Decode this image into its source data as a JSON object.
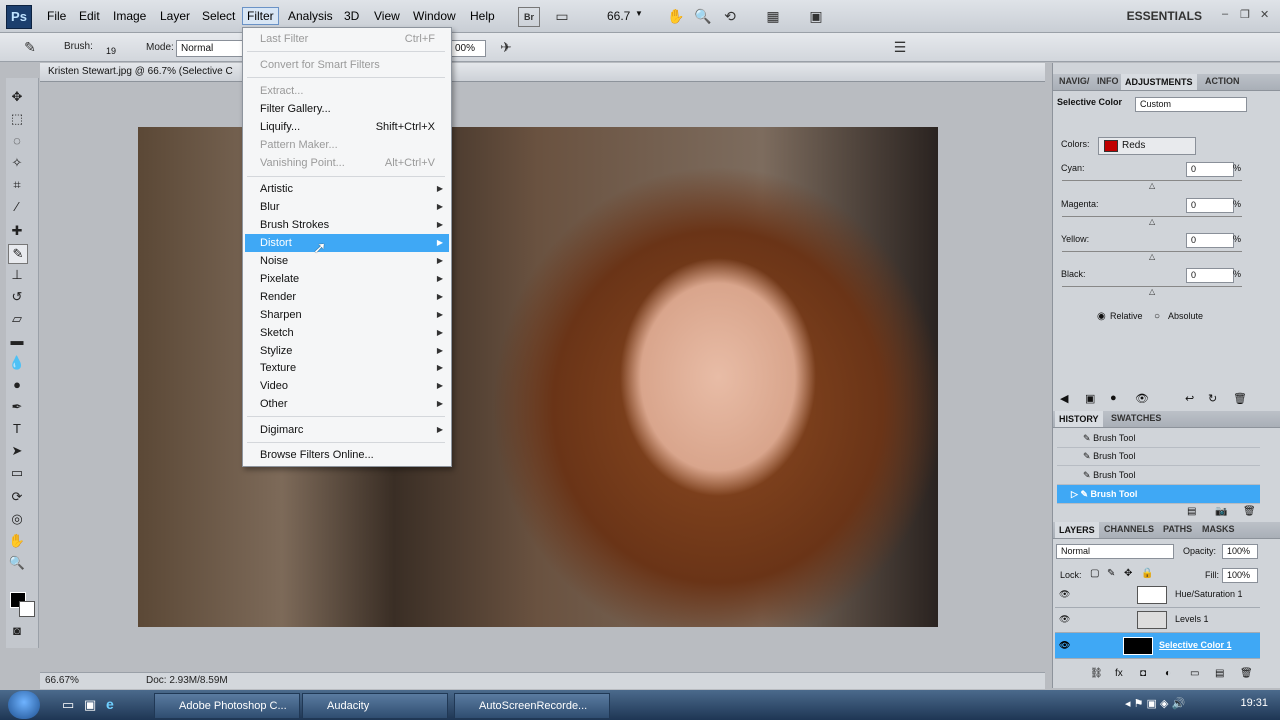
{
  "menubar": {
    "logo": "Ps",
    "items": [
      "File",
      "Edit",
      "Image",
      "Layer",
      "Select",
      "Filter",
      "Analysis",
      "3D",
      "View",
      "Window",
      "Help"
    ],
    "br": "Br",
    "zoom": "66.7",
    "workspace": "ESSENTIALS"
  },
  "options": {
    "brush_label": "Brush:",
    "brush_size": "19",
    "mode_label": "Mode:",
    "mode_value": "Normal",
    "flow_value": "00%"
  },
  "document": {
    "title": "Kristen Stewart.jpg @ 66.7% (Selective C",
    "zoom": "66.67%",
    "doc_size": "Doc: 2.93M/8.59M"
  },
  "filter_menu": {
    "items": [
      {
        "label": "Last Filter",
        "shortcut": "Ctrl+F",
        "disabled": true
      },
      {
        "label": "Convert for Smart Filters",
        "disabled": true
      },
      {
        "label": "Extract...",
        "disabled": true
      },
      {
        "label": "Filter Gallery..."
      },
      {
        "label": "Liquify...",
        "shortcut": "Shift+Ctrl+X"
      },
      {
        "label": "Pattern Maker...",
        "disabled": true
      },
      {
        "label": "Vanishing Point...",
        "shortcut": "Alt+Ctrl+V",
        "disabled": true
      },
      {
        "label": "Artistic",
        "submenu": true
      },
      {
        "label": "Blur",
        "submenu": true
      },
      {
        "label": "Brush Strokes",
        "submenu": true
      },
      {
        "label": "Distort",
        "submenu": true,
        "highlighted": true
      },
      {
        "label": "Noise",
        "submenu": true
      },
      {
        "label": "Pixelate",
        "submenu": true
      },
      {
        "label": "Render",
        "submenu": true
      },
      {
        "label": "Sharpen",
        "submenu": true
      },
      {
        "label": "Sketch",
        "submenu": true
      },
      {
        "label": "Stylize",
        "submenu": true
      },
      {
        "label": "Texture",
        "submenu": true
      },
      {
        "label": "Video",
        "submenu": true
      },
      {
        "label": "Other",
        "submenu": true
      },
      {
        "label": "Digimarc",
        "submenu": true
      },
      {
        "label": "Browse Filters Online..."
      }
    ]
  },
  "adjustments": {
    "tabs": [
      "NAVIG/",
      "INFO",
      "ADJUSTMENTS",
      "ACTION"
    ],
    "title": "Selective Color",
    "preset": "Custom",
    "colors_label": "Colors:",
    "colors_value": "Reds",
    "swatch_color": "#c00000",
    "sliders": [
      {
        "label": "Cyan:",
        "value": "0",
        "unit": "%"
      },
      {
        "label": "Magenta:",
        "value": "0",
        "unit": "%"
      },
      {
        "label": "Yellow:",
        "value": "0",
        "unit": "%"
      },
      {
        "label": "Black:",
        "value": "0",
        "unit": "%"
      }
    ],
    "relative": "Relative",
    "absolute": "Absolute"
  },
  "history": {
    "tabs": [
      "HISTORY",
      "SWATCHES"
    ],
    "items": [
      "Brush Tool",
      "Brush Tool",
      "Brush Tool",
      "Brush Tool"
    ]
  },
  "layers": {
    "tabs": [
      "LAYERS",
      "CHANNELS",
      "PATHS",
      "MASKS"
    ],
    "blend": "Normal",
    "opacity_label": "Opacity:",
    "opacity": "100%",
    "lock_label": "Lock:",
    "fill_label": "Fill:",
    "fill": "100%",
    "items": [
      "Hue/Saturation 1",
      "Levels 1",
      "Selective Color 1"
    ]
  },
  "taskbar": {
    "tasks": [
      "Adobe Photoshop C...",
      "Audacity",
      "AutoScreenRecorde..."
    ],
    "clock": "19:31"
  }
}
